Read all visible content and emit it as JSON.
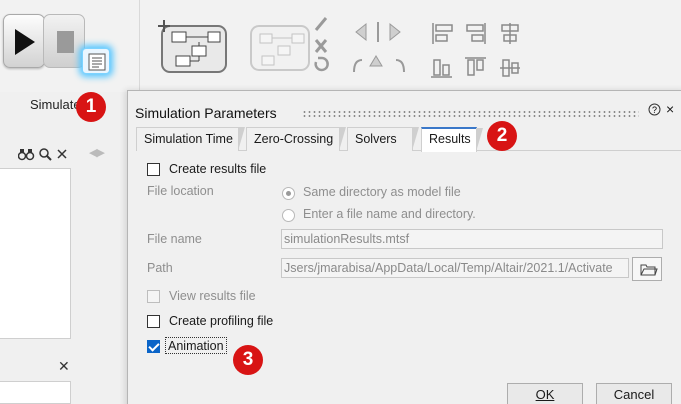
{
  "toolbar": {
    "simulate_label": "Simulate",
    "play_icon": "play-icon",
    "stop_icon": "stop-icon",
    "sim_params_icon": "simulation-parameters-icon"
  },
  "left_panel": {
    "tools": [
      "binoculars-icon",
      "search-icon",
      "close-icon"
    ]
  },
  "dialog": {
    "title": "Simulation Parameters",
    "help_glyph": "?",
    "close_glyph": "×",
    "tabs": [
      {
        "label": "Simulation Time",
        "active": false
      },
      {
        "label": "Zero-Crossing",
        "active": false
      },
      {
        "label": "Solvers",
        "active": false
      },
      {
        "label": "Results",
        "active": true
      }
    ],
    "results": {
      "create_results_file": {
        "label": "Create results file",
        "checked": false
      },
      "file_location_label": "File location",
      "radio_same_dir": "Same directory as model file",
      "radio_enter_name": "Enter a file name and directory.",
      "file_name_label": "File name",
      "file_name_value": "simulationResults.mtsf",
      "path_label": "Path",
      "path_value": "Jsers/jmarabisa/AppData/Local/Temp/Altair/2021.1/Activate",
      "view_results_file": {
        "label": "View results file",
        "checked": false,
        "disabled": true
      },
      "create_profiling_file": {
        "label": "Create profiling file",
        "checked": false
      },
      "animation": {
        "label": "Animation",
        "checked": true
      }
    },
    "ok_label": "OK",
    "cancel_label": "Cancel"
  },
  "badges": [
    "1",
    "2",
    "3"
  ],
  "colors": {
    "badge_red": "#d81414",
    "checkbox_blue": "#0a64c8",
    "active_tab_accent": "#3a78c9",
    "glow_blue": "#56c6ff"
  }
}
